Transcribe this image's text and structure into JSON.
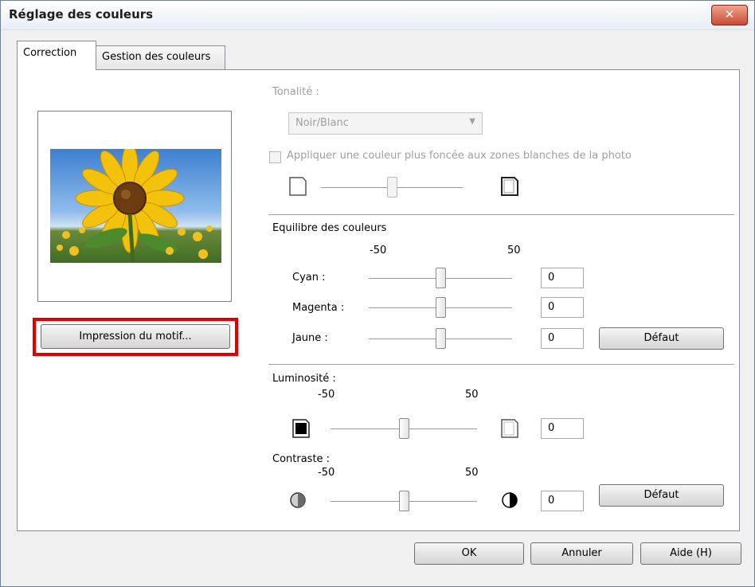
{
  "window": {
    "title": "Réglage des couleurs",
    "close_glyph": "✕"
  },
  "tabs": [
    {
      "label": "Correction",
      "active": true
    },
    {
      "label": "Gestion des couleurs",
      "active": false
    }
  ],
  "preview": {
    "image": "sunflower-photo"
  },
  "pattern_print_button": "Impression du motif...",
  "tonality": {
    "label": "Tonalité :",
    "selected": "Noir/Blanc",
    "enabled": false,
    "darker_checkbox_label": "Appliquer une couleur plus foncée aux zones blanches de la photo",
    "darker_checked": false,
    "slider_level": 0.5
  },
  "color_balance": {
    "heading": "Equilibre des couleurs",
    "min_label": "-50",
    "max_label": "50",
    "rows": [
      {
        "label": "Cyan :",
        "value": "0"
      },
      {
        "label": "Magenta :",
        "value": "0"
      },
      {
        "label": "Jaune :",
        "value": "0"
      }
    ],
    "default_button": "Défaut"
  },
  "brightness": {
    "label": "Luminosité :",
    "min_label": "-50",
    "max_label": "50",
    "value": "0"
  },
  "contrast": {
    "label": "Contraste :",
    "min_label": "-50",
    "max_label": "50",
    "value": "0",
    "default_button": "Défaut"
  },
  "footer": {
    "ok": "OK",
    "cancel": "Annuler",
    "help": "Aide (H)"
  },
  "icons": {
    "close": "close-icon",
    "dark_square": "brightness-dark-icon",
    "light_page": "brightness-light-icon",
    "contrast_low": "contrast-low-icon",
    "contrast_high": "contrast-high-icon"
  }
}
